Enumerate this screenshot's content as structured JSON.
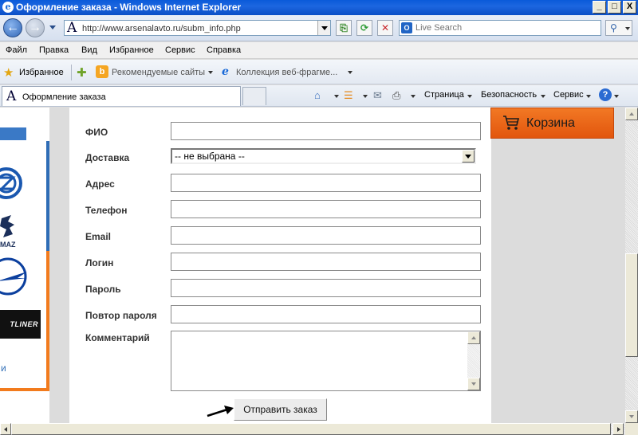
{
  "window": {
    "title": "Оформление заказа - Windows Internet Explorer",
    "minimize": "_",
    "maximize": "□",
    "close": "X"
  },
  "address_bar": {
    "url": "http://www.arsenalavto.ru/subm_info.php",
    "site_icon_letter": "A",
    "search_placeholder": "Live Search"
  },
  "menu": {
    "items": [
      "Файл",
      "Правка",
      "Вид",
      "Избранное",
      "Сервис",
      "Справка"
    ]
  },
  "favorites_bar": {
    "favorites_label": "Избранное",
    "recommended_sites": "Рекомендуемые сайты",
    "web_slice_gallery": "Коллекция веб-фрагме..."
  },
  "tab": {
    "title": "Оформление заказа",
    "icon_letter": "A"
  },
  "command_bar": {
    "page": "Страница",
    "safety": "Безопасность",
    "tools": "Сервис",
    "help": "?"
  },
  "left_sidebar": {
    "link_fragment": "и",
    "brand_text": "TLINER",
    "maz_text": "MAZ"
  },
  "form": {
    "fields": {
      "name": {
        "label": "ФИО",
        "value": ""
      },
      "delivery": {
        "label": "Доставка",
        "selected": "-- не выбрана --"
      },
      "address": {
        "label": "Адрес",
        "value": ""
      },
      "phone": {
        "label": "Телефон",
        "value": ""
      },
      "email": {
        "label": "Email",
        "value": ""
      },
      "login": {
        "label": "Логин",
        "value": ""
      },
      "password": {
        "label": "Пароль",
        "value": ""
      },
      "password_repeat": {
        "label": "Повтор пароля",
        "value": ""
      },
      "comment": {
        "label": "Комментарий",
        "value": ""
      }
    },
    "submit_label": "Отправить заказ"
  },
  "cart": {
    "label": "Корзина"
  },
  "colors": {
    "title_bar": "#0a5ad9",
    "cart_orange": "#e2560d",
    "sidebar_blue": "#2f6db6",
    "sidebar_orange": "#f27b1d"
  }
}
